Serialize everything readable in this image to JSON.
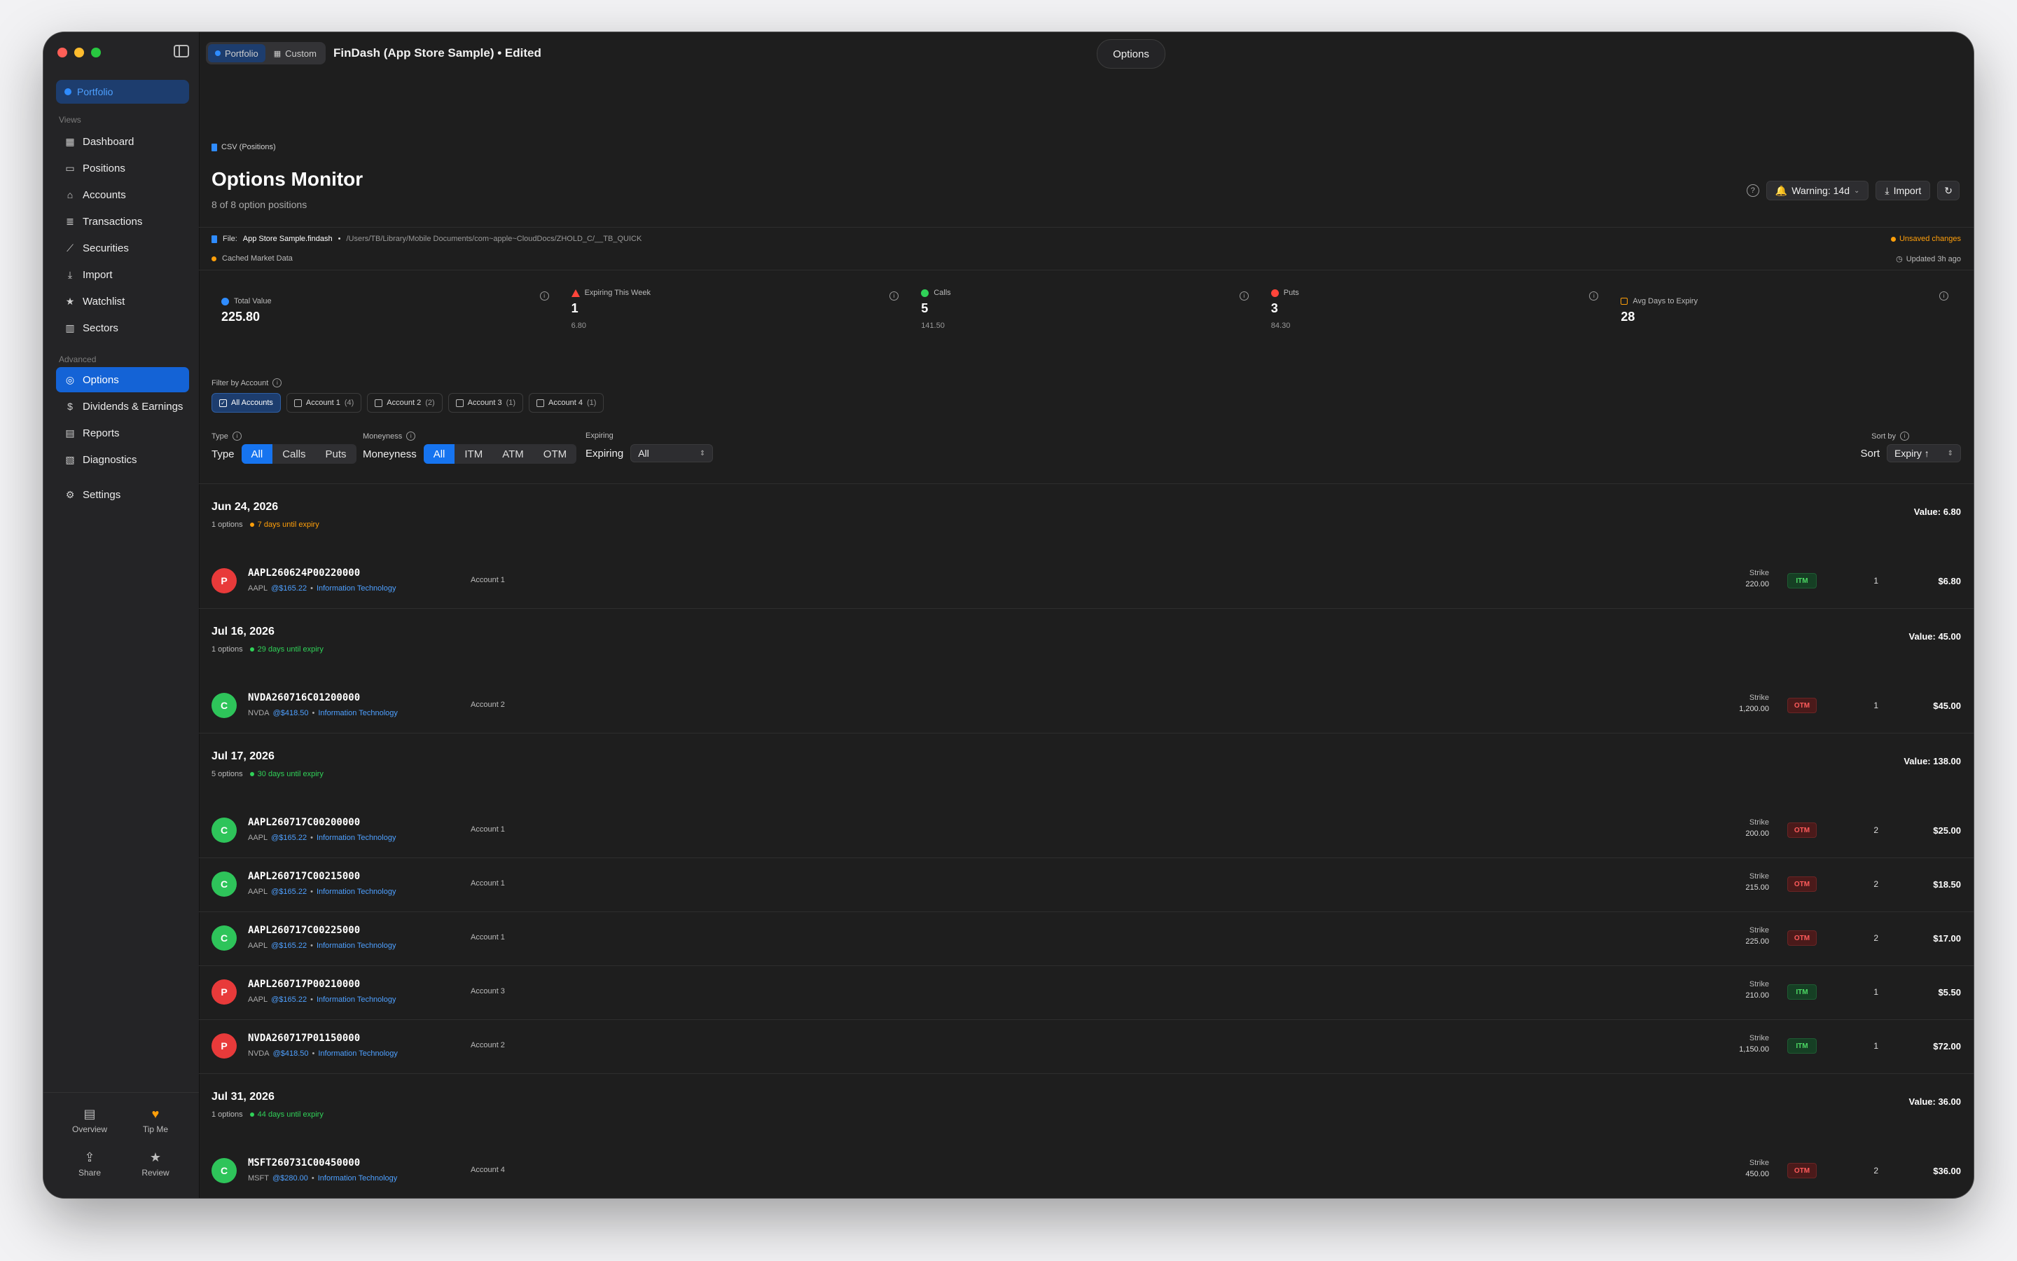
{
  "window": {
    "toolbar": {
      "seg_portfolio": "Portfolio",
      "seg_custom": "Custom",
      "doc_title": "FinDash (App Store Sample) • Edited",
      "center_button": "Options"
    }
  },
  "sidebar": {
    "portfolio_button": "Portfolio",
    "views_label": "Views",
    "views": [
      {
        "label": "Dashboard",
        "icon": "grid-icon"
      },
      {
        "label": "Positions",
        "icon": "briefcase-icon"
      },
      {
        "label": "Accounts",
        "icon": "bank-icon"
      },
      {
        "label": "Transactions",
        "icon": "list-icon"
      },
      {
        "label": "Securities",
        "icon": "chart-icon"
      },
      {
        "label": "Import",
        "icon": "import-icon"
      },
      {
        "label": "Watchlist",
        "icon": "star-icon"
      },
      {
        "label": "Sectors",
        "icon": "building-icon"
      }
    ],
    "advanced_label": "Advanced",
    "advanced": [
      {
        "label": "Options",
        "icon": "options-icon",
        "active": true
      },
      {
        "label": "Dividends & Earnings",
        "icon": "dollar-icon"
      },
      {
        "label": "Reports",
        "icon": "report-icon"
      },
      {
        "label": "Diagnostics",
        "icon": "diagnostics-icon"
      }
    ],
    "settings": "Settings",
    "bottom": {
      "overview": "Overview",
      "tip_me": "Tip Me",
      "share": "Share",
      "review": "Review"
    }
  },
  "header": {
    "breadcrumb": "CSV (Positions)",
    "title": "Options Monitor",
    "subtitle": "8 of 8 option positions",
    "warning_button": "Warning: 14d",
    "import_button": "Import"
  },
  "filebar": {
    "file_label": "File:",
    "file_name": "App Store Sample.findash",
    "separator": "•",
    "file_path": "/Users/TB/Library/Mobile Documents/com~apple~CloudDocs/ZHOLD_C/__TB_QUICK",
    "unsaved": "Unsaved changes",
    "cached": "Cached Market Data",
    "updated": "Updated 3h ago"
  },
  "stats": [
    {
      "label": "Total Value",
      "value": "225.80",
      "sub": "",
      "dot": "#2f8cff",
      "marker": "circle"
    },
    {
      "label": "Expiring This Week",
      "value": "1",
      "sub": "6.80",
      "dot": "#ff453a",
      "marker": "triangle"
    },
    {
      "label": "Calls",
      "value": "5",
      "sub": "141.50",
      "dot": "#30d158",
      "marker": "circle"
    },
    {
      "label": "Puts",
      "value": "3",
      "sub": "84.30",
      "dot": "#ff453a",
      "marker": "circle"
    },
    {
      "label": "Avg Days to Expiry",
      "value": "28",
      "sub": "",
      "dot": "#ff9f0a",
      "marker": "calendar"
    }
  ],
  "filters": {
    "account_label": "Filter by Account",
    "accounts": [
      {
        "label": "All Accounts",
        "count": "",
        "selected": true
      },
      {
        "label": "Account 1",
        "count": "(4)",
        "selected": false
      },
      {
        "label": "Account 2",
        "count": "(2)",
        "selected": false
      },
      {
        "label": "Account 3",
        "count": "(1)",
        "selected": false
      },
      {
        "label": "Account 4",
        "count": "(1)",
        "selected": false
      }
    ],
    "type_label": "Type",
    "type_options": [
      "All",
      "Calls",
      "Puts"
    ],
    "moneyness_label": "Moneyness",
    "moneyness_options": [
      "All",
      "ITM",
      "ATM",
      "OTM"
    ],
    "expiring_label": "Expiring",
    "expiring_value": "All",
    "sort_by_label": "Sort by",
    "sort_label": "Sort",
    "sort_value": "Expiry ↑"
  },
  "groups": [
    {
      "date": "Jun 24, 2026",
      "count": "1 options",
      "days": "7 days until expiry",
      "days_color": "#ff9f0a",
      "value": "Value: 6.80",
      "rows": [
        {
          "type": "P",
          "symbol": "AAPL260624P00220000",
          "ticker": "AAPL",
          "price": "@$165.22",
          "sector": "Information Technology",
          "account": "Account 1",
          "strike": "220.00",
          "moneyness": "ITM",
          "qty": "1",
          "value": "$6.80"
        }
      ]
    },
    {
      "date": "Jul 16, 2026",
      "count": "1 options",
      "days": "29 days until expiry",
      "days_color": "#30d158",
      "value": "Value: 45.00",
      "rows": [
        {
          "type": "C",
          "symbol": "NVDA260716C01200000",
          "ticker": "NVDA",
          "price": "@$418.50",
          "sector": "Information Technology",
          "account": "Account 2",
          "strike": "1,200.00",
          "moneyness": "OTM",
          "qty": "1",
          "value": "$45.00"
        }
      ]
    },
    {
      "date": "Jul 17, 2026",
      "count": "5 options",
      "days": "30 days until expiry",
      "days_color": "#30d158",
      "value": "Value: 138.00",
      "rows": [
        {
          "type": "C",
          "symbol": "AAPL260717C00200000",
          "ticker": "AAPL",
          "price": "@$165.22",
          "sector": "Information Technology",
          "account": "Account 1",
          "strike": "200.00",
          "moneyness": "OTM",
          "qty": "2",
          "value": "$25.00"
        },
        {
          "type": "C",
          "symbol": "AAPL260717C00215000",
          "ticker": "AAPL",
          "price": "@$165.22",
          "sector": "Information Technology",
          "account": "Account 1",
          "strike": "215.00",
          "moneyness": "OTM",
          "qty": "2",
          "value": "$18.50"
        },
        {
          "type": "C",
          "symbol": "AAPL260717C00225000",
          "ticker": "AAPL",
          "price": "@$165.22",
          "sector": "Information Technology",
          "account": "Account 1",
          "strike": "225.00",
          "moneyness": "OTM",
          "qty": "2",
          "value": "$17.00"
        },
        {
          "type": "P",
          "symbol": "AAPL260717P00210000",
          "ticker": "AAPL",
          "price": "@$165.22",
          "sector": "Information Technology",
          "account": "Account 3",
          "strike": "210.00",
          "moneyness": "ITM",
          "qty": "1",
          "value": "$5.50"
        },
        {
          "type": "P",
          "symbol": "NVDA260717P01150000",
          "ticker": "NVDA",
          "price": "@$418.50",
          "sector": "Information Technology",
          "account": "Account 2",
          "strike": "1,150.00",
          "moneyness": "ITM",
          "qty": "1",
          "value": "$72.00"
        }
      ]
    },
    {
      "date": "Jul 31, 2026",
      "count": "1 options",
      "days": "44 days until expiry",
      "days_color": "#30d158",
      "value": "Value: 36.00",
      "rows": [
        {
          "type": "C",
          "symbol": "MSFT260731C00450000",
          "ticker": "MSFT",
          "price": "@$280.00",
          "sector": "Information Technology",
          "account": "Account 4",
          "strike": "450.00",
          "moneyness": "OTM",
          "qty": "2",
          "value": "$36.00"
        }
      ]
    }
  ],
  "labels": {
    "strike": "Strike",
    "dot_sep": "•"
  }
}
